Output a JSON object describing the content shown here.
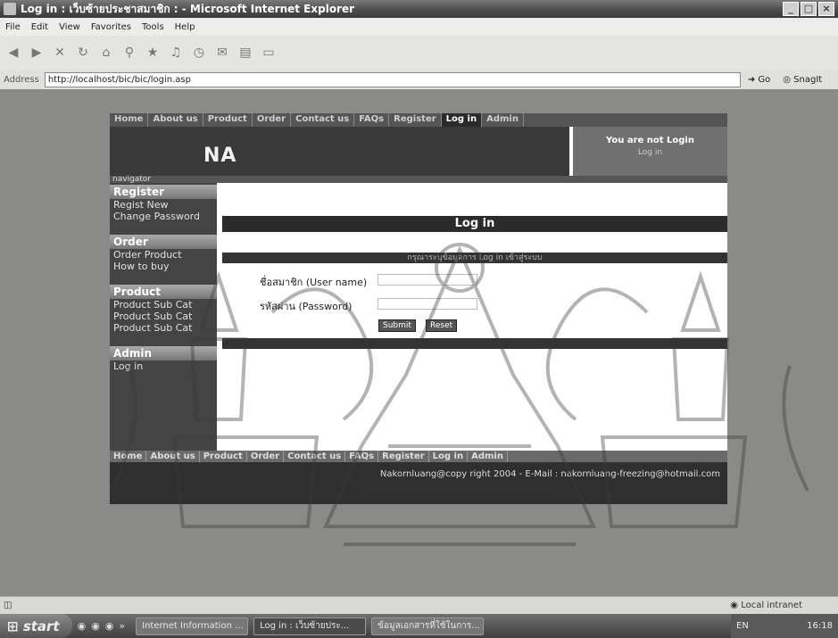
{
  "window": {
    "title": "Log in : เว็บซ้ายประชาสมาชิก : - Microsoft Internet Explorer",
    "controls": [
      "_",
      "□",
      "×"
    ]
  },
  "menubar": [
    "File",
    "Edit",
    "View",
    "Favorites",
    "Tools",
    "Help"
  ],
  "address": {
    "label": "Address",
    "url": "http://localhost/bic/bic/login.asp",
    "go": "Go",
    "snagit": "SnagIt"
  },
  "site": {
    "topnav": [
      "Home",
      "About us",
      "Product",
      "Order",
      "Contact us",
      "FAQs",
      "Register",
      "Log in",
      "Admin"
    ],
    "active_tab": "Log in",
    "logo": "NA",
    "login_status": {
      "line1": "You are not Login",
      "line2": "Log in"
    },
    "navigator_label": "navigator",
    "sidebar": [
      {
        "heading": "Register",
        "items": [
          "Regist New",
          "Change Password"
        ]
      },
      {
        "heading": "Order",
        "items": [
          "Order Product",
          "How to buy"
        ]
      },
      {
        "heading": "Product",
        "items": [
          "Product Sub Cat",
          "Product Sub Cat",
          "Product Sub Cat"
        ]
      },
      {
        "heading": "Admin",
        "items": [
          "Log in"
        ]
      }
    ],
    "form": {
      "title": "Log in",
      "subtitle": "กรุณาระบุข้อมูลการ Log in เข้าสู่ระบบ",
      "username_label": "ชื่อสมาชิก (User name)",
      "password_label": "รหัสผ่าน (Password)",
      "login_button": "Submit",
      "reset_button": "Reset"
    },
    "bottomnav": [
      "Home",
      "About us",
      "Product",
      "Order",
      "Contact us",
      "FAQs",
      "Register",
      "Log in",
      "Admin"
    ],
    "footer": "Nakornluang@copy right 2004 - E-Mail : nakornluang-freezing@hotmail.com"
  },
  "statusbar": {
    "zone": "Local intranet"
  },
  "taskbar": {
    "start": "start",
    "tasks": [
      "Internet Information ...",
      "Log in : เว็บซ้ายประ...",
      "ข้อมูลเอกสารที่ใช้ในการ..."
    ],
    "tray_lang": "EN",
    "clock": "16:18"
  }
}
